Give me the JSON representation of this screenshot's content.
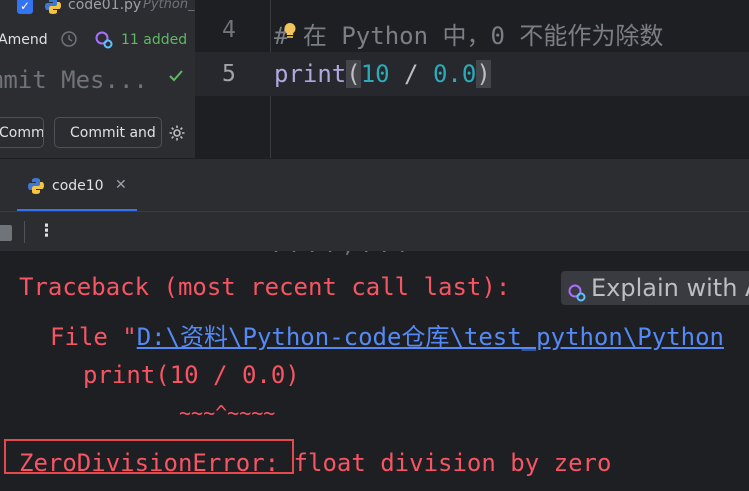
{
  "commit_panel": {
    "file_name": "code01.py",
    "file_suffix": "Python_",
    "amend_label": "Amend",
    "added_text": "11 added",
    "commit_message_placeholder": "Commit Mes...",
    "commit_button": "Commit",
    "commit_push_button": "Commit and Push..."
  },
  "editor": {
    "lines": [
      {
        "number": "4",
        "text": "# 在 Python 中，0 不能作为除数"
      },
      {
        "number": "5",
        "print": "print",
        "open": "(",
        "a": "10",
        "op": " / ",
        "b": "0.0",
        "close": ")"
      }
    ]
  },
  "run_window": {
    "tab_label": "code10",
    "console": {
      "prev_fragment": "....,...",
      "traceback": "Traceback (most recent call last):",
      "explain_chip": "Explain with AI",
      "file_prefix": "File \"",
      "file_path": "D:\\资料\\Python-code仓库\\test_python\\Python",
      "print_line": "print(10 / 0.0)",
      "caret_line": "~~~^~~~~",
      "error_name": "ZeroDivisionError",
      "error_message": ": float division by zero"
    }
  },
  "colors": {
    "accent": "#3574f0",
    "error": "#f75464",
    "link": "#548af7",
    "success": "#5fb865",
    "highlight_box": "#e5484d"
  }
}
